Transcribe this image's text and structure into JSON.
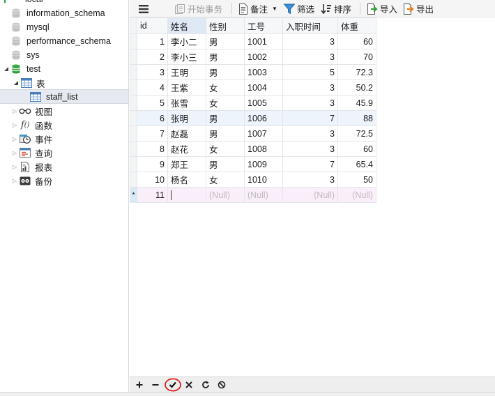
{
  "sidebar": {
    "connection": "local",
    "databases": [
      "information_schema",
      "mysql",
      "performance_schema",
      "sys",
      "test"
    ],
    "tables_node": "表",
    "table_name": "staff_list",
    "groups": [
      "视图",
      "函数",
      "事件",
      "查询",
      "报表",
      "备份"
    ]
  },
  "toolbar": {
    "begin_transaction": "开始事务",
    "note": "备注",
    "filter": "筛选",
    "sort": "排序",
    "import": "导入",
    "export": "导出"
  },
  "grid": {
    "columns": [
      "id",
      "姓名",
      "性别",
      "工号",
      "入职时间",
      "体重"
    ],
    "rows": [
      [
        "1",
        "李小二",
        "男",
        "1001",
        "3",
        "60"
      ],
      [
        "2",
        "李小三",
        "男",
        "1002",
        "3",
        "70"
      ],
      [
        "3",
        "王明",
        "男",
        "1003",
        "5",
        "72.3"
      ],
      [
        "4",
        "王紫",
        "女",
        "1004",
        "3",
        "50.2"
      ],
      [
        "5",
        "张雪",
        "女",
        "1005",
        "3",
        "45.9"
      ],
      [
        "6",
        "张明",
        "男",
        "1006",
        "7",
        "88"
      ],
      [
        "7",
        "赵磊",
        "男",
        "1007",
        "3",
        "72.5"
      ],
      [
        "8",
        "赵花",
        "女",
        "1008",
        "3",
        "60"
      ],
      [
        "9",
        "郑王",
        "男",
        "1009",
        "7",
        "65.4"
      ],
      [
        "10",
        "杨名",
        "女",
        "1010",
        "3",
        "50"
      ]
    ],
    "new_row": {
      "marker": "*",
      "id": "11",
      "null_text": "(Null)"
    }
  },
  "colors": {
    "accent_blue": "#1a73c9",
    "green": "#2e9e3a",
    "highlight_circle": "#e02020",
    "new_row_bg": "#fbeefb"
  }
}
